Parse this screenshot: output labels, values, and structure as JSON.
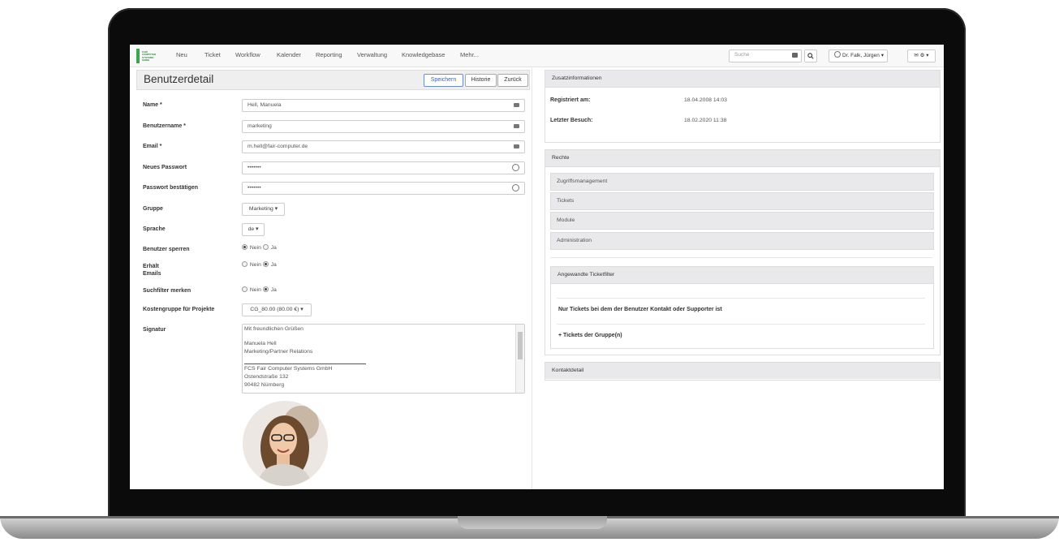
{
  "nav": {
    "logo_text": "FAIR COMPUTER SYSTEMS GMBH",
    "items": [
      "Neu",
      "Ticket",
      "Workflow",
      "Kalender",
      "Reporting",
      "Verwaltung",
      "Knowledgebase",
      "Mehr..."
    ],
    "search_placeholder": "Suche",
    "user": "Dr. Falk, Jürgen",
    "user_caret": "▾",
    "mail": "✉ ⚙ ▾"
  },
  "page": {
    "title": "Benutzerdetail",
    "buttons": {
      "save": "Speichern",
      "history": "Historie",
      "back": "Zurück"
    }
  },
  "form": {
    "name_label": "Name *",
    "name_value": "Hell, Manuela",
    "username_label": "Benutzername *",
    "username_value": "marketing",
    "email_label": "Email *",
    "email_value": "m.hell@fair-computer.de",
    "newpass_label": "Neues Passwort",
    "newpass_value": "•••••••",
    "confirm_label": "Passwort bestätigen",
    "confirm_value": "•••••••",
    "group_label": "Gruppe",
    "group_value": "Marketing ▾",
    "lang_label": "Sprache",
    "lang_value": "de ▾",
    "lock_label": "Benutzer sperren",
    "lock_no": "Nein",
    "lock_yes": "Ja",
    "emails_label_1": "Erhält",
    "emails_label_2": "Emails",
    "emails_no": "Nein",
    "emails_yes": "Ja",
    "filter_label": "Suchfilter merken",
    "filter_no": "Nein",
    "filter_yes": "Ja",
    "cost_label": "Kostengruppe für Projekte",
    "cost_value": "CG_80.00 (80.00 €) ▾",
    "signature_label": "Signatur",
    "signature_lines": [
      "Mit freundlichen Grüßen",
      "",
      "Manuela Hell",
      "Marketing/Partner Relations",
      "",
      "FCS Fair Computer Systems GmbH",
      "Ostendstraße 132",
      "90482 Nürnberg"
    ]
  },
  "info": {
    "title": "Zusatzinformationen",
    "registered_label": "Registriert am:",
    "registered_value": "18.04.2008 14:03",
    "last_visit_label": "Letzter Besuch:",
    "last_visit_value": "18.02.2020 11:38"
  },
  "rights": {
    "title": "Rechte",
    "items": [
      "Zugriffsmanagement",
      "Tickets",
      "Module",
      "Administration"
    ],
    "filter_title": "Angewandte Ticketfilter",
    "filter_rule": "Nur Tickets bei dem der Benutzer Kontakt oder Supporter ist",
    "filter_group": "+ Tickets der Gruppe(n)"
  },
  "contact": {
    "title": "Kontaktdetail"
  },
  "colors": {
    "green": "#3aa54a",
    "primary": "#3a64b3",
    "panel_head": "#e9e9ec"
  }
}
